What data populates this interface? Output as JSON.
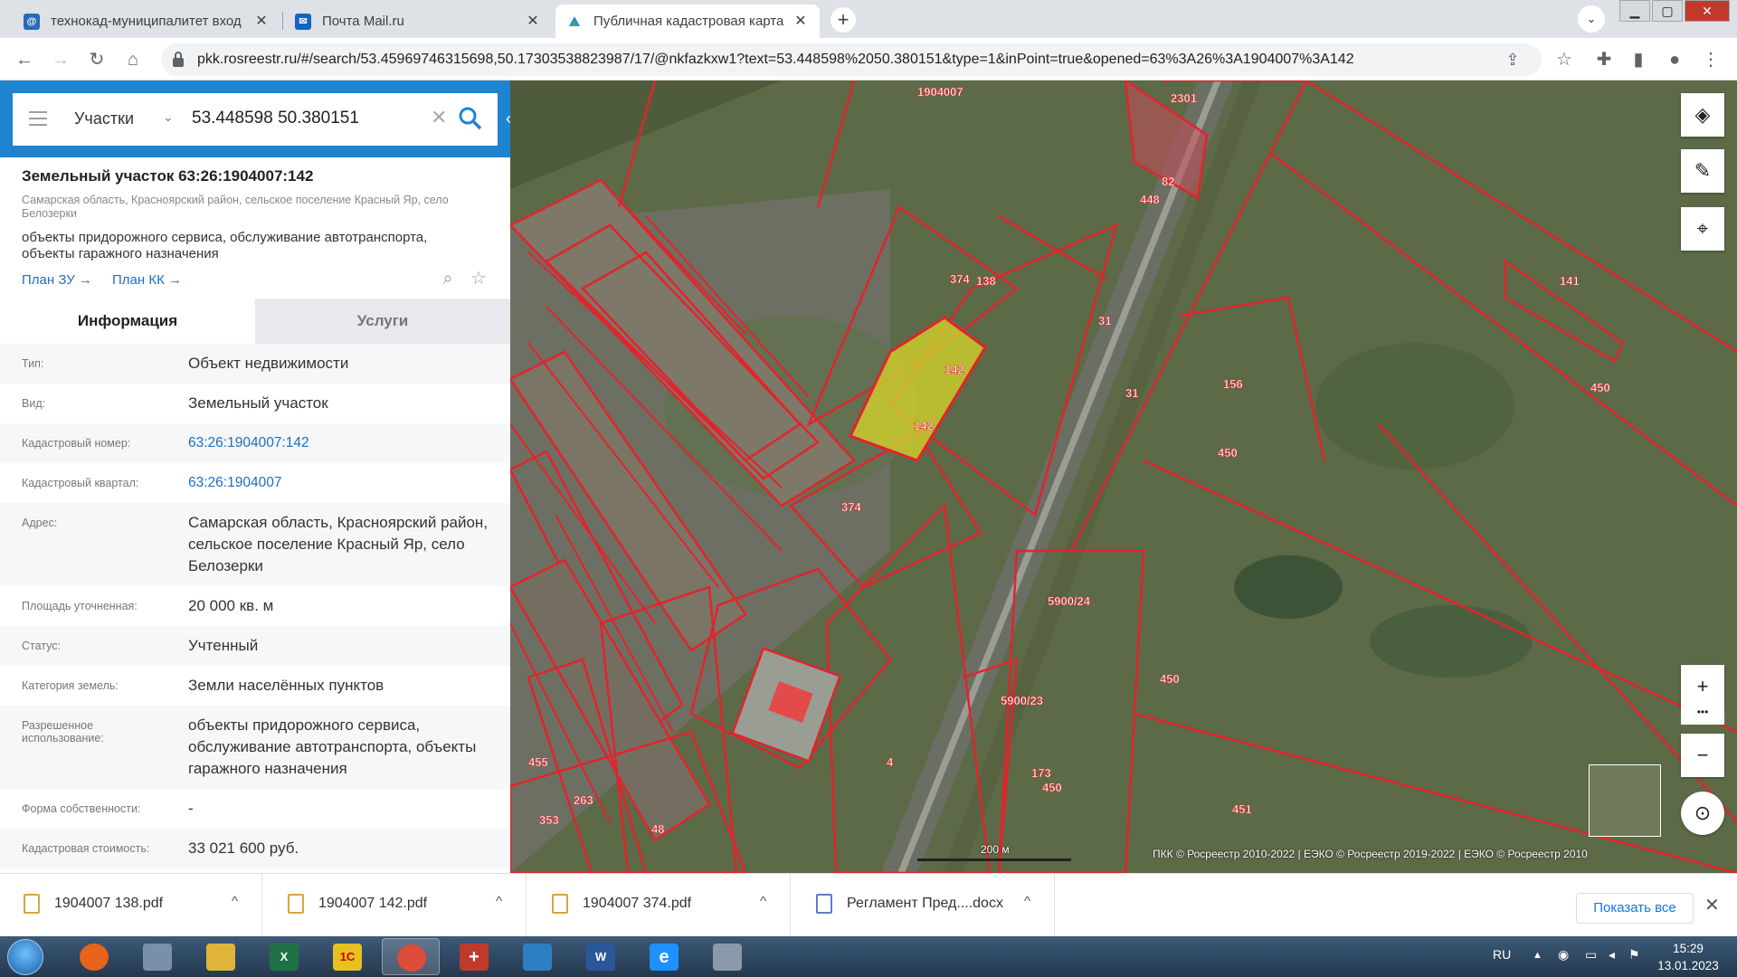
{
  "browser": {
    "tabs": [
      {
        "title": "технокад-муниципалитет вход",
        "favicon": "at-sign-icon"
      },
      {
        "title": "Почта Mail.ru",
        "favicon": "mail-icon"
      },
      {
        "title": "Публичная кадастровая карта",
        "favicon": "cadastre-icon"
      }
    ],
    "url": "pkk.rosreestr.ru/#/search/53.45969746315698,50.17303538823987/17/@nkfazkxw1?text=53.448598%2050.380151&type=1&inPoint=true&opened=63%3A26%3A1904007%3A142",
    "new_tab": "+",
    "tab_search": "⌄",
    "window_controls": [
      "▁",
      "▢",
      "✕"
    ]
  },
  "search": {
    "type_label": "Участки",
    "query": "53.448598 50.380151"
  },
  "parcel": {
    "title": "Земельный участок 63:26:1904007:142",
    "address_short": "Самарская область, Красноярский район, сельское поселение Красный Яр, село Белозерки",
    "use_short": "объекты придорожного сервиса, обслуживание автотранспорта, объекты гаражного назначения",
    "plan_zu": "План ЗУ →",
    "plan_kk": "План КК →"
  },
  "info_tabs": {
    "info": "Информация",
    "services": "Услуги"
  },
  "info_rows": [
    {
      "key": "Тип:",
      "value": "Объект недвижимости"
    },
    {
      "key": "Вид:",
      "value": "Земельный участок"
    },
    {
      "key": "Кадастровый номер:",
      "value": "63:26:1904007:142"
    },
    {
      "key": "Кадастровый квартал:",
      "value": "63:26:1904007"
    },
    {
      "key": "Адрес:",
      "value": "Самарская область, Красноярский район, сельское поселение Красный Яр, село Белозерки"
    },
    {
      "key": "Площадь уточненная:",
      "value": "20 000 кв. м"
    },
    {
      "key": "Статус:",
      "value": "Учтенный"
    },
    {
      "key": "Категория земель:",
      "value": "Земли населённых пунктов"
    },
    {
      "key": "Разрешенное использование:",
      "value": "объекты придорожного сервиса, обслуживание автотранспорта, объекты гаражного назначения"
    },
    {
      "key": "Форма собственности:",
      "value": "-"
    },
    {
      "key": "Кадастровая стоимость:",
      "value": "33 021 600 руб."
    }
  ],
  "map": {
    "labels": [
      "1904007",
      "2301",
      "138",
      "374",
      "142",
      "142",
      "374",
      "31",
      "31",
      "156",
      "450",
      "450",
      "450",
      "450",
      "141",
      "5900/24",
      "5900/23",
      "173",
      "451",
      "4",
      "48",
      "353",
      "263",
      "455",
      "82",
      "448"
    ],
    "scale": "200 м",
    "attribution": "ПКК © Росреестр 2010-2022 | ЕЭКО © Росреестр 2019-2022 | ЕЭКО © Росреестр 2010",
    "zoom_in": "+",
    "zoom_more": "•••",
    "zoom_out": "−",
    "highlight_color": "#d4d42a",
    "boundary_color": "#e3232c"
  },
  "downloads": [
    {
      "name": "1904007 138.pdf",
      "icon": "pdf-icon"
    },
    {
      "name": "1904007 142.pdf",
      "icon": "pdf-icon"
    },
    {
      "name": "1904007 374.pdf",
      "icon": "pdf-icon"
    },
    {
      "name": "Регламент Пред....docx",
      "icon": "docx-icon"
    }
  ],
  "downloads_show_all": "Показать все",
  "taskbar": {
    "apps": [
      {
        "label": "",
        "icon": "firefox-icon",
        "color": "#e8631a"
      },
      {
        "label": "",
        "icon": "magnifier-icon",
        "color": "#7a8fa8"
      },
      {
        "label": "",
        "icon": "explorer-icon",
        "color": "#e0b43a"
      },
      {
        "label": "X",
        "icon": "excel-icon",
        "color": "#1e7145"
      },
      {
        "label": "1С",
        "icon": "1c-icon",
        "color": "#e8c020"
      },
      {
        "label": "",
        "icon": "chrome-icon",
        "color": "#dd4b39"
      },
      {
        "label": "+",
        "icon": "cross-icon",
        "color": "#c0392b"
      },
      {
        "label": "",
        "icon": "cube-icon",
        "color": "#2d7fc1"
      },
      {
        "label": "W",
        "icon": "word-icon",
        "color": "#2b579a"
      },
      {
        "label": "e",
        "icon": "ie-icon",
        "color": "#1e90ff"
      },
      {
        "label": "",
        "icon": "scholar-icon",
        "color": "#8a9aab"
      }
    ],
    "lang": "RU",
    "time": "15:29",
    "date": "13.01.2023"
  }
}
